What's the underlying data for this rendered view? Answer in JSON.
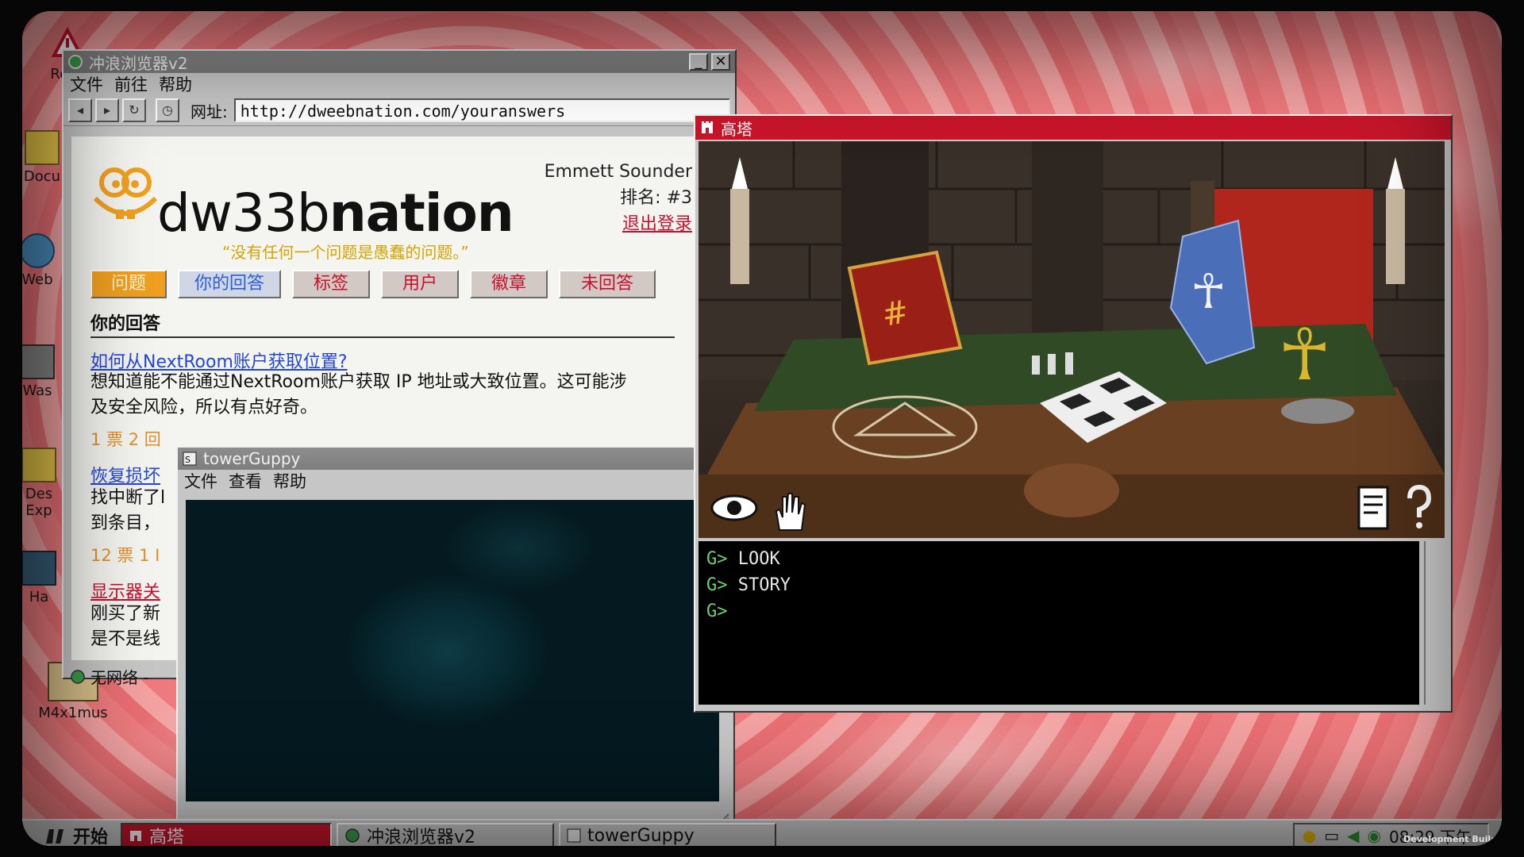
{
  "desktop": {
    "icons": [
      {
        "label": "Re Is"
      },
      {
        "label": "Docu"
      },
      {
        "label": "Web"
      },
      {
        "label": "Was"
      },
      {
        "label": "Des Exp"
      },
      {
        "label": "Ha"
      },
      {
        "label": "M4x1mus"
      }
    ],
    "dev_build": "Development Build"
  },
  "browser": {
    "title": "冲浪浏览器v2",
    "menu": [
      "文件",
      "前往",
      "帮助"
    ],
    "address_label": "网址:",
    "url": "http://dweebnation.com/youranswers",
    "status": "无网络 -",
    "site": {
      "logo_light": "dw33b",
      "logo_bold": "nation",
      "tagline": "“没有任何一个问题是愚蠢的问题。”",
      "user_name": "Emmett Sounder",
      "rank": "排名: #3",
      "logout": "退出登录",
      "tabs": [
        "问题",
        "你的回答",
        "标签",
        "用户",
        "徽章",
        "未回答"
      ],
      "section_title": "你的回答",
      "questions": [
        {
          "title": "如何从NextRoom账户获取位置?",
          "body1": "想知道能不能通过NextRoom账户获取 IP 地址或大致位置。这可能涉",
          "body2": "及安全风险，所以有点好奇。",
          "meta": "1 票 2 回"
        },
        {
          "title": "恢复损坏",
          "body1": "找中断了l",
          "body2": "到条目，",
          "meta": "12 票 1 I"
        },
        {
          "title": "显示器关",
          "body1": "刚买了新",
          "body2": "是不是线"
        }
      ]
    }
  },
  "guppy": {
    "title": "towerGuppy",
    "menu": [
      "文件",
      "查看",
      "帮助"
    ]
  },
  "tower": {
    "title": "高塔",
    "console": [
      {
        "prompt": "G>",
        "text": "LOOK"
      },
      {
        "prompt": "G>",
        "text": "STORY"
      },
      {
        "prompt": "G>",
        "text": ""
      }
    ]
  },
  "taskbar": {
    "start": "开始",
    "tasks": [
      "高塔",
      "冲浪浏览器v2",
      "towerGuppy"
    ],
    "clock": "08:29 下午"
  },
  "colors": {
    "tower_titlebar": "#c8152a",
    "link_blue": "#2446d8",
    "link_red": "#c8102e",
    "tagline": "#d4a400",
    "console_prompt": "#6bd56b"
  }
}
